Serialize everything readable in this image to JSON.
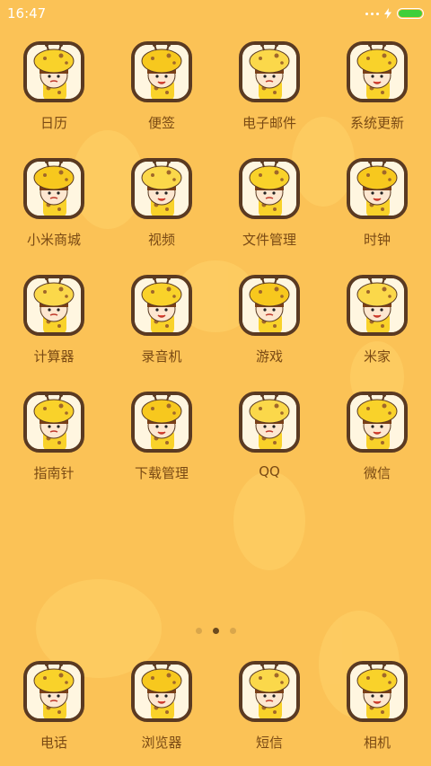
{
  "status_bar": {
    "time": "16:47"
  },
  "apps": [
    {
      "label": "日历",
      "icon": "giraffe-calendar-icon"
    },
    {
      "label": "便签",
      "icon": "giraffe-notes-icon"
    },
    {
      "label": "电子邮件",
      "icon": "giraffe-email-icon"
    },
    {
      "label": "系统更新",
      "icon": "giraffe-update-icon"
    },
    {
      "label": "小米商城",
      "icon": "giraffe-store-icon"
    },
    {
      "label": "视频",
      "icon": "giraffe-video-icon"
    },
    {
      "label": "文件管理",
      "icon": "giraffe-files-icon"
    },
    {
      "label": "时钟",
      "icon": "giraffe-clock-icon"
    },
    {
      "label": "计算器",
      "icon": "giraffe-calculator-icon"
    },
    {
      "label": "录音机",
      "icon": "giraffe-recorder-icon"
    },
    {
      "label": "游戏",
      "icon": "giraffe-games-icon"
    },
    {
      "label": "米家",
      "icon": "giraffe-mihome-icon"
    },
    {
      "label": "指南针",
      "icon": "giraffe-compass-icon"
    },
    {
      "label": "下载管理",
      "icon": "giraffe-downloads-icon"
    },
    {
      "label": "QQ",
      "icon": "giraffe-qq-icon"
    },
    {
      "label": "微信",
      "icon": "giraffe-wechat-icon"
    }
  ],
  "pages": {
    "count": 3,
    "active": 2
  },
  "dock": [
    {
      "label": "电话",
      "icon": "giraffe-phone-icon"
    },
    {
      "label": "浏览器",
      "icon": "giraffe-browser-icon"
    },
    {
      "label": "短信",
      "icon": "giraffe-messages-icon"
    },
    {
      "label": "相机",
      "icon": "giraffe-camera-icon"
    }
  ],
  "colors": {
    "background": "#fbc256",
    "icon_border": "#5a3a22",
    "giraffe_yellow": "#f9d22a",
    "label_text": "#7a4a14",
    "battery": "#3fcf3a"
  }
}
